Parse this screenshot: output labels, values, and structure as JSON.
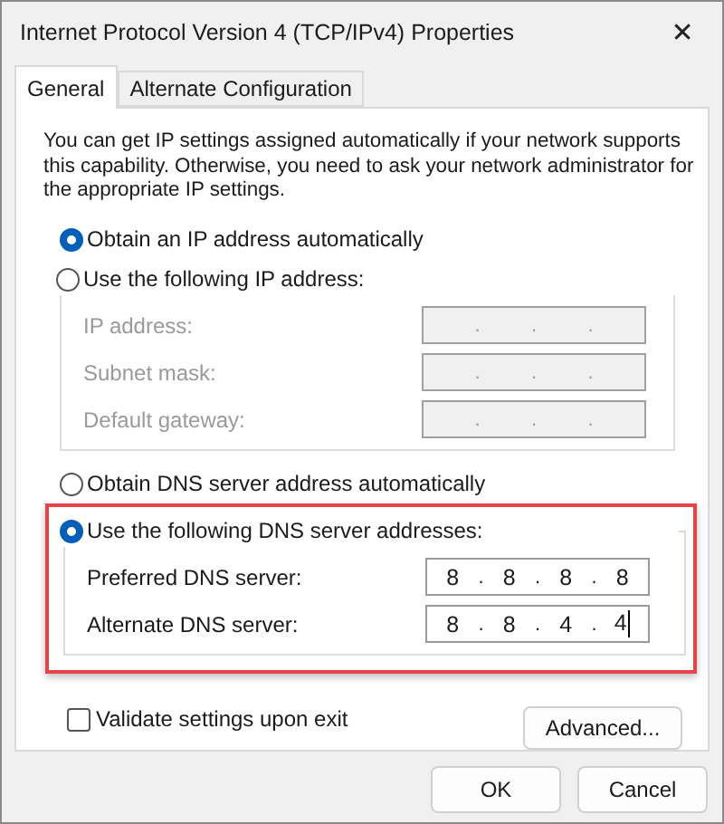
{
  "window": {
    "title": "Internet Protocol Version 4 (TCP/IPv4) Properties",
    "close_glyph": "✕"
  },
  "tabs": [
    {
      "label": "General",
      "selected": true
    },
    {
      "label": "Alternate Configuration",
      "selected": false
    }
  ],
  "intro": "You can get IP settings assigned automatically if your network supports this capability. Otherwise, you need to ask your network administrator for the appropriate IP settings.",
  "ip_section": {
    "auto_option": {
      "label": "Obtain an IP address automatically",
      "selected": true
    },
    "manual_option": {
      "label": "Use the following IP address:",
      "selected": false
    },
    "fields": [
      {
        "label": "IP address:",
        "disabled": true,
        "separator": "."
      },
      {
        "label": "Subnet mask:",
        "disabled": true,
        "separator": "."
      },
      {
        "label": "Default gateway:",
        "disabled": true,
        "separator": "."
      }
    ]
  },
  "dns_section": {
    "highlighted": true,
    "auto_option": {
      "label": "Obtain DNS server address automatically",
      "selected": false
    },
    "manual_option": {
      "label": "Use the following DNS server addresses:",
      "selected": true
    },
    "fields": [
      {
        "label": "Preferred DNS server:",
        "disabled": false,
        "separator": ".",
        "octets": [
          "8",
          "8",
          "8",
          "8"
        ],
        "focused": false
      },
      {
        "label": "Alternate DNS server:",
        "disabled": false,
        "separator": ".",
        "octets": [
          "8",
          "8",
          "4",
          "4"
        ],
        "focused": true
      }
    ]
  },
  "validate": {
    "label": "Validate settings upon exit",
    "checked": false
  },
  "advanced_button": "Advanced...",
  "buttons": [
    "OK",
    "Cancel"
  ]
}
